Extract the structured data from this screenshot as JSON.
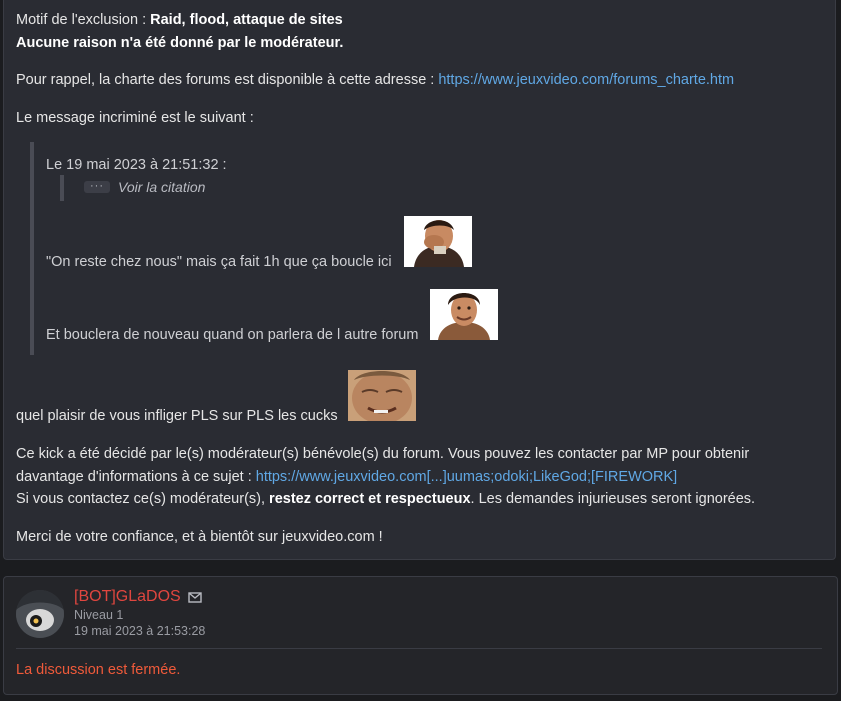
{
  "message": {
    "motif_label": "Motif de l'exclusion : ",
    "motif_value": "Raid, flood, attaque de sites",
    "no_reason": "Aucune raison n'a été donné par le modérateur.",
    "charte_text": "Pour rappel, la charte des forums est disponible à cette adresse : ",
    "charte_link": "https://www.jeuxvideo.com/forums_charte.htm",
    "incrimine": "Le message incriminé est le suivant :",
    "quote": {
      "header": "Le 19 mai 2023 à 21:51:32 :",
      "dots": "···",
      "voir": "Voir la citation",
      "line1": "\"On reste chez nous\" mais ça fait 1h que ça boucle ici",
      "line2": "Et bouclera de nouveau quand on parlera de l autre forum"
    },
    "main_line": "quel plaisir de vous infliger PLS sur PLS les cucks",
    "kick_line1": "Ce kick a été décidé par le(s) modérateur(s) bénévole(s) du forum. Vous pouvez les contacter par MP pour obtenir",
    "kick_line2_prefix": "davantage d'informations à ce sujet : ",
    "kick_link": "https://www.jeuxvideo.com[...]uumas;odoki;LikeGod;[FIREWORK]",
    "contact_prefix": "Si vous contactez ce(s) modérateur(s), ",
    "contact_bold": "restez correct et respectueux",
    "contact_suffix": ". Les demandes injurieuses seront ignorées.",
    "thanks": "Merci de votre confiance, et à bientôt sur jeuxvideo.com !"
  },
  "post2": {
    "username": "[BOT]GLaDOS",
    "level": "Niveau 1",
    "date": "19 mai 2023 à 21:53:28",
    "body": "La discussion est fermée."
  }
}
